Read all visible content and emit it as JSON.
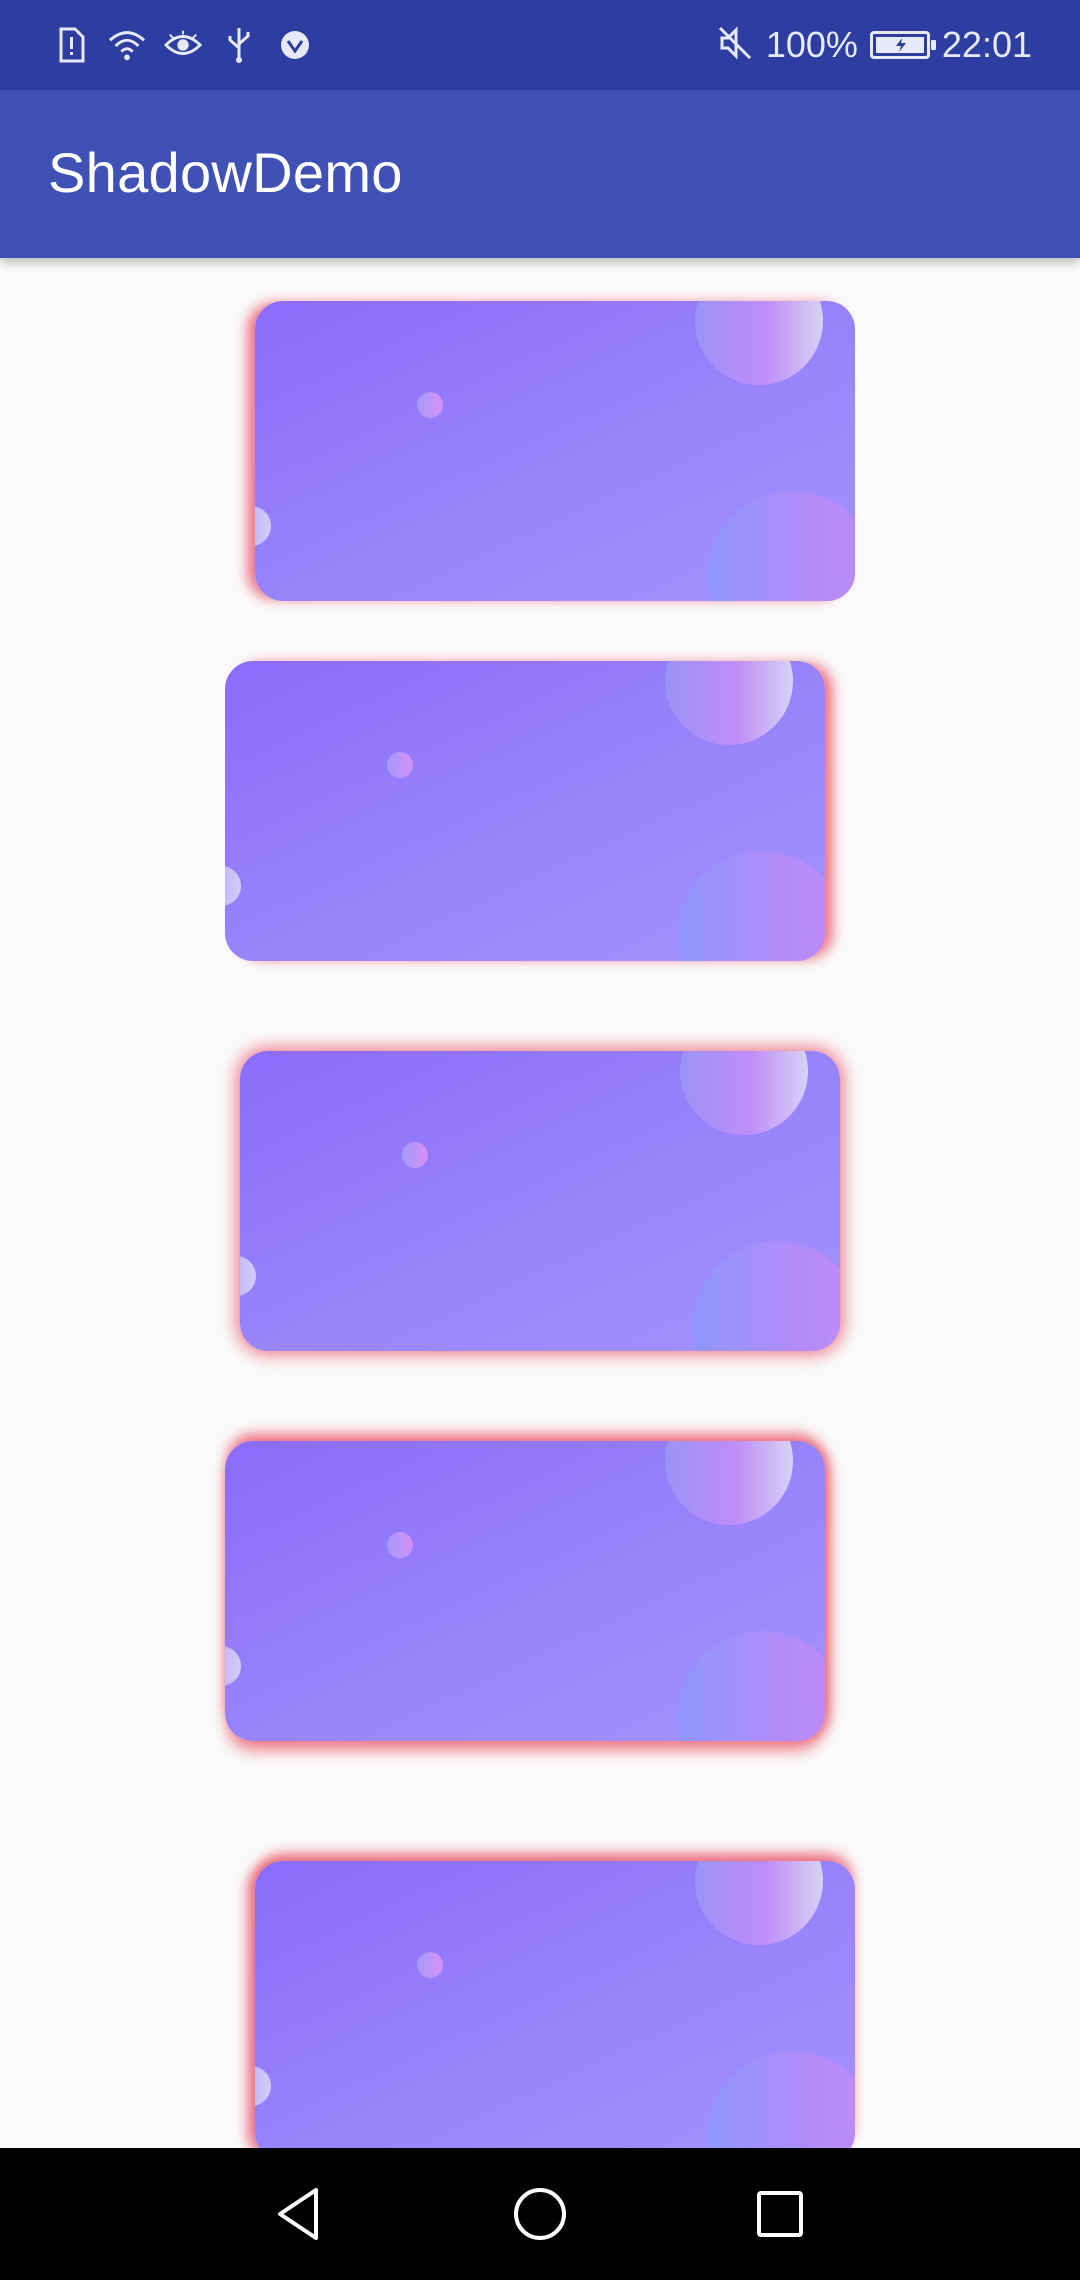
{
  "status_bar": {
    "icons_left": [
      "sim-alert-icon",
      "wifi-icon",
      "eye-icon",
      "usb-icon",
      "vpn-icon"
    ],
    "mute_icon": "mute-icon",
    "battery_text": "100%",
    "time": "22:01",
    "colors": {
      "background": "#2d3ea0",
      "foreground": "#e6e9f7"
    }
  },
  "app_bar": {
    "title": "ShadowDemo",
    "colors": {
      "background": "#3f51b5",
      "title": "#ffffff"
    }
  },
  "cards": [
    {
      "name": "shadow-card-1",
      "shadow_color": "#e84a5f",
      "shadow_side": "left"
    },
    {
      "name": "shadow-card-2",
      "shadow_color": "#e84a5f",
      "shadow_side": "right"
    },
    {
      "name": "shadow-card-3",
      "shadow_color": "#e84a5f",
      "shadow_side": "all"
    },
    {
      "name": "shadow-card-4",
      "shadow_color": "#e84a5f",
      "shadow_side": "top-bottom-right"
    },
    {
      "name": "shadow-card-5",
      "shadow_color": "#e84a5f",
      "shadow_side": "top-left"
    }
  ],
  "nav_bar": {
    "buttons": [
      "back-icon",
      "home-icon",
      "recents-icon"
    ],
    "colors": {
      "background": "#000000",
      "icon": "#ffffff"
    }
  }
}
